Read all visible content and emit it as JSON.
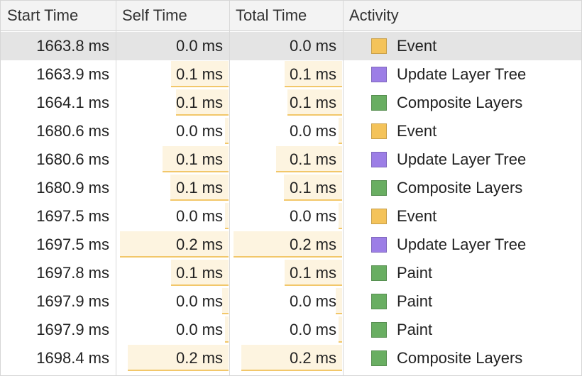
{
  "columns": {
    "start": "Start Time",
    "self": "Self Time",
    "total": "Total Time",
    "activity": "Activity"
  },
  "colors": {
    "Event": "#f4c35a",
    "Update Layer Tree": "#9c7ee6",
    "Composite Layers": "#69ae62",
    "Paint": "#69ae62"
  },
  "rows": [
    {
      "start": "1663.8 ms",
      "self": "0.0 ms",
      "total": "0.0 ms",
      "activity": "Event",
      "icon": "event-swatch-icon",
      "self_fraction": 0.0,
      "total_fraction": 0.0,
      "selected": true
    },
    {
      "start": "1663.9 ms",
      "self": "0.1 ms",
      "total": "0.1 ms",
      "activity": "Update Layer Tree",
      "icon": "update-layer-tree-swatch-icon",
      "self_fraction": 0.51,
      "total_fraction": 0.51,
      "selected": false
    },
    {
      "start": "1664.1 ms",
      "self": "0.1 ms",
      "total": "0.1 ms",
      "activity": "Composite Layers",
      "icon": "composite-layers-swatch-icon",
      "self_fraction": 0.47,
      "total_fraction": 0.49,
      "selected": false
    },
    {
      "start": "1680.6 ms",
      "self": "0.0 ms",
      "total": "0.0 ms",
      "activity": "Event",
      "icon": "event-swatch-icon",
      "self_fraction": 0.03,
      "total_fraction": 0.03,
      "selected": false
    },
    {
      "start": "1680.6 ms",
      "self": "0.1 ms",
      "total": "0.1 ms",
      "activity": "Update Layer Tree",
      "icon": "update-layer-tree-swatch-icon",
      "self_fraction": 0.59,
      "total_fraction": 0.59,
      "selected": false
    },
    {
      "start": "1680.9 ms",
      "self": "0.1 ms",
      "total": "0.1 ms",
      "activity": "Composite Layers",
      "icon": "composite-layers-swatch-icon",
      "self_fraction": 0.52,
      "total_fraction": 0.52,
      "selected": false
    },
    {
      "start": "1697.5 ms",
      "self": "0.0 ms",
      "total": "0.0 ms",
      "activity": "Event",
      "icon": "event-swatch-icon",
      "self_fraction": 0.03,
      "total_fraction": 0.03,
      "selected": false
    },
    {
      "start": "1697.5 ms",
      "self": "0.2 ms",
      "total": "0.2 ms",
      "activity": "Update Layer Tree",
      "icon": "update-layer-tree-swatch-icon",
      "self_fraction": 0.97,
      "total_fraction": 0.97,
      "selected": false
    },
    {
      "start": "1697.8 ms",
      "self": "0.1 ms",
      "total": "0.1 ms",
      "activity": "Paint",
      "icon": "paint-swatch-icon",
      "self_fraction": 0.51,
      "total_fraction": 0.51,
      "selected": false
    },
    {
      "start": "1697.9 ms",
      "self": "0.0 ms",
      "total": "0.0 ms",
      "activity": "Paint",
      "icon": "paint-swatch-icon",
      "self_fraction": 0.06,
      "total_fraction": 0.06,
      "selected": false
    },
    {
      "start": "1697.9 ms",
      "self": "0.0 ms",
      "total": "0.0 ms",
      "activity": "Paint",
      "icon": "paint-swatch-icon",
      "self_fraction": 0.03,
      "total_fraction": 0.03,
      "selected": false
    },
    {
      "start": "1698.4 ms",
      "self": "0.2 ms",
      "total": "0.2 ms",
      "activity": "Composite Layers",
      "icon": "composite-layers-swatch-icon",
      "self_fraction": 0.9,
      "total_fraction": 0.9,
      "selected": false
    }
  ]
}
